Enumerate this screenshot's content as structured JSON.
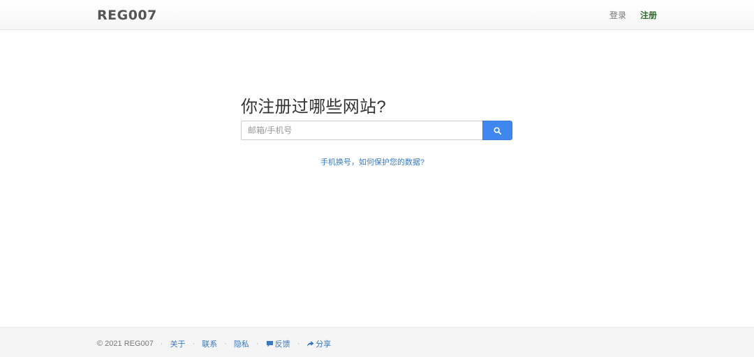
{
  "navbar": {
    "brand": "REG007",
    "links": [
      {
        "label": "登录",
        "active": false
      },
      {
        "label": "注册",
        "active": true
      }
    ]
  },
  "main": {
    "title": "你注册过哪些网站?",
    "search": {
      "placeholder": "邮箱/手机号",
      "value": "",
      "button_icon": "search-icon"
    },
    "help_link": "手机换号，如何保护您的数据?"
  },
  "footer": {
    "copyright": "© 2021 REG007",
    "links": [
      {
        "label": "关于"
      },
      {
        "label": "联系"
      },
      {
        "label": "隐私"
      },
      {
        "label": "反馈",
        "icon": "comment-icon"
      },
      {
        "label": "分享",
        "icon": "share-icon"
      }
    ],
    "separator": "·"
  },
  "colors": {
    "accent": "#3f86ee",
    "link": "#3a78c3",
    "active_nav": "#2e6b2e"
  }
}
